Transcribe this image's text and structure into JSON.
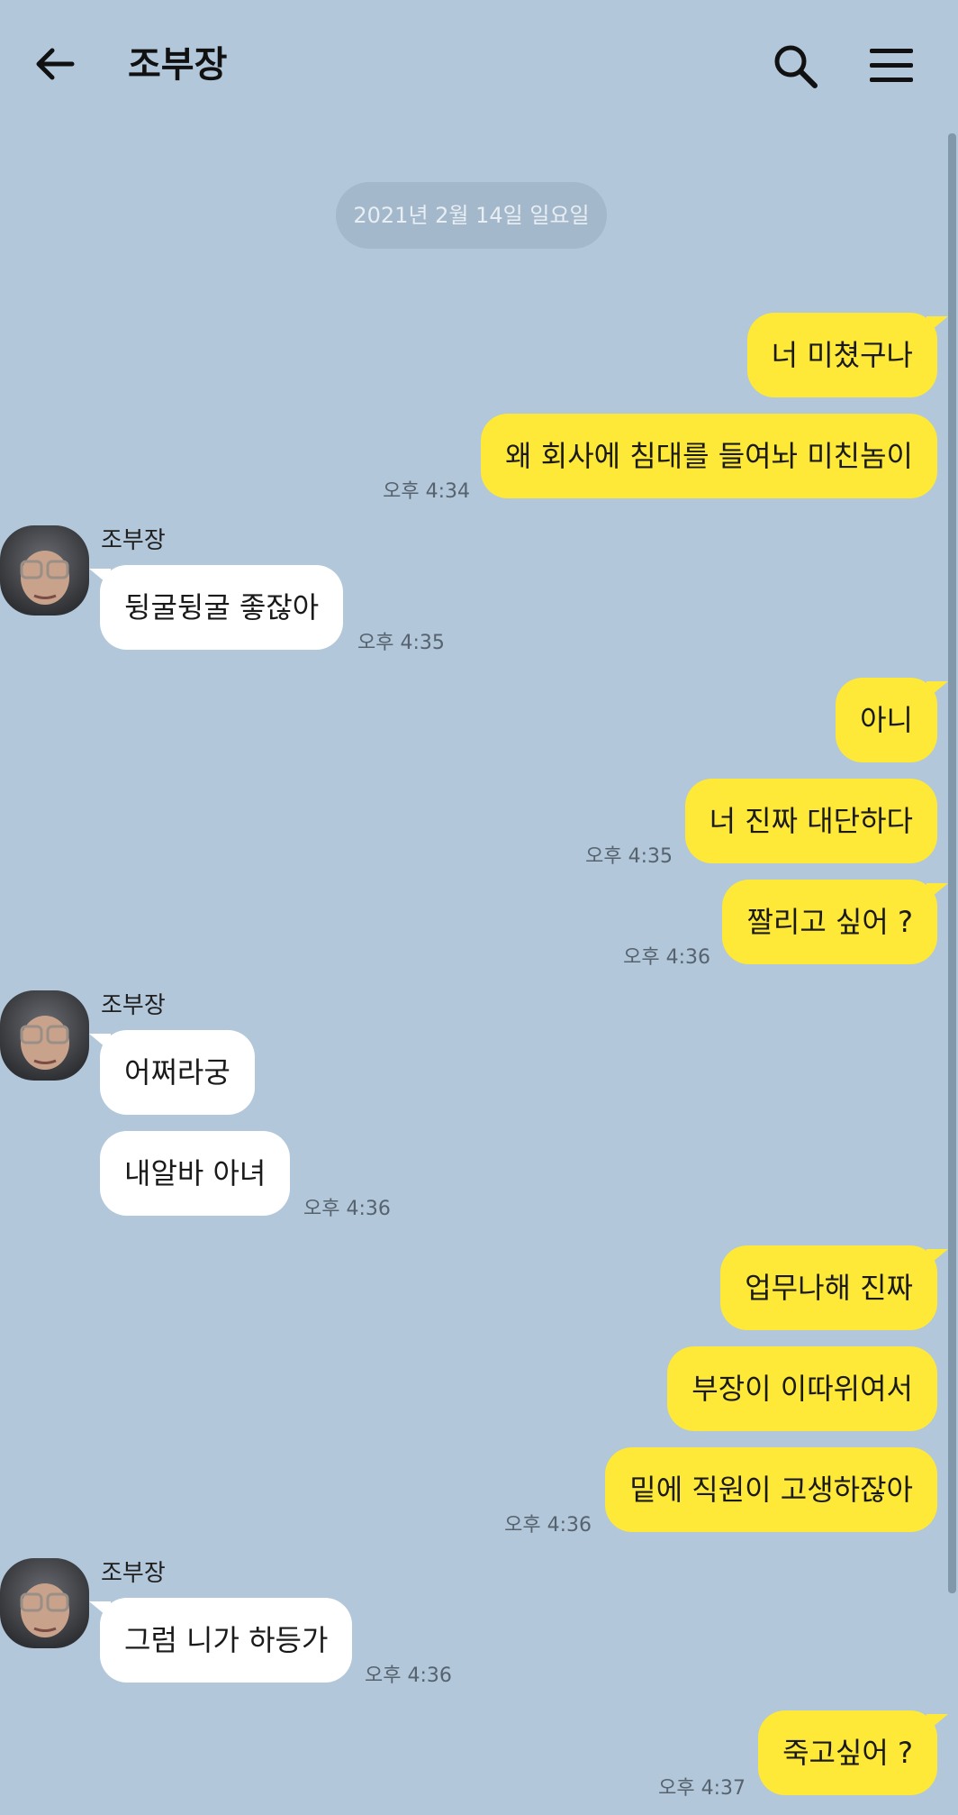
{
  "header": {
    "title": "조부장",
    "back_icon": "arrow-left-icon",
    "search_icon": "search-icon",
    "menu_icon": "hamburger-menu-icon"
  },
  "colors": {
    "background": "#b2c7da",
    "my_bubble": "#fee838",
    "other_bubble": "#ffffff"
  },
  "date_divider": "2021년 2월 14일 일요일",
  "messages": [
    {
      "from": "me",
      "text": "너 미쳤구나"
    },
    {
      "from": "me",
      "text": "왜 회사에 침대를 들여놔 미친놈이",
      "time": "오후 4:34"
    },
    {
      "from": "other",
      "sender": "조부장",
      "text": "뒹굴뒹굴 좋잖아",
      "time": "오후 4:35"
    },
    {
      "from": "me",
      "text": "아니"
    },
    {
      "from": "me",
      "text": "너 진짜 대단하다",
      "time": "오후 4:35"
    },
    {
      "from": "me",
      "text": "짤리고 싶어 ?",
      "time": "오후 4:36"
    },
    {
      "from": "other",
      "sender": "조부장",
      "text": "어쩌라궁"
    },
    {
      "from": "other",
      "text": "내알바 아녀",
      "time": "오후 4:36"
    },
    {
      "from": "me",
      "text": "업무나해 진짜"
    },
    {
      "from": "me",
      "text": "부장이 이따위여서"
    },
    {
      "from": "me",
      "text": "밑에 직원이 고생하잖아",
      "time": "오후 4:36"
    },
    {
      "from": "other",
      "sender": "조부장",
      "text": "그럼 니가 하등가",
      "time": "오후 4:36"
    },
    {
      "from": "me",
      "text": "죽고싶어 ?",
      "time": "오후 4:37"
    }
  ]
}
